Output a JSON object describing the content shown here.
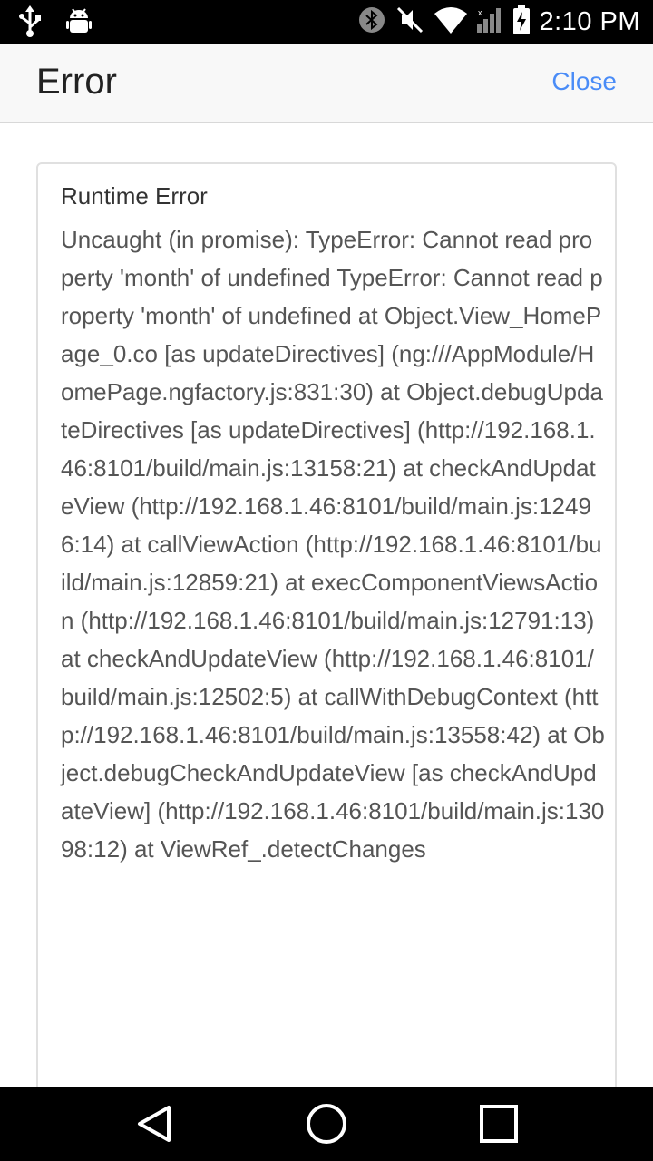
{
  "status_bar": {
    "time": "2:10 PM",
    "icons": [
      "usb-icon",
      "android-debug-icon",
      "bluetooth-icon",
      "mute-icon",
      "wifi-icon",
      "signal-icon",
      "battery-charging-icon"
    ]
  },
  "header": {
    "title": "Error",
    "close_label": "Close"
  },
  "error": {
    "title": "Runtime Error",
    "message": "Uncaught (in promise): TypeError: Cannot read property 'month' of undefined TypeError: Cannot read property 'month' of undefined at Object.View_HomePage_0.co [as updateDirectives] (ng:///AppModule/HomePage.ngfactory.js:831:30) at Object.debugUpdateDirectives [as updateDirectives] (http://192.168.1.46:8101/build/main.js:13158:21) at checkAndUpdateView (http://192.168.1.46:8101/build/main.js:12496:14) at callViewAction (http://192.168.1.46:8101/build/main.js:12859:21) at execComponentViewsAction (http://192.168.1.46:8101/build/main.js:12791:13) at checkAndUpdateView (http://192.168.1.46:8101/build/main.js:12502:5) at callWithDebugContext (http://192.168.1.46:8101/build/main.js:13558:42) at Object.debugCheckAndUpdateView [as checkAndUpdateView] (http://192.168.1.46:8101/build/main.js:13098:12) at ViewRef_.detectChanges"
  },
  "nav_bar": {
    "buttons": [
      "back-icon",
      "home-icon",
      "recents-icon"
    ]
  },
  "colors": {
    "accent": "#4a8cf7",
    "status_bar": "#000000",
    "header_bg": "#f8f8f8"
  }
}
